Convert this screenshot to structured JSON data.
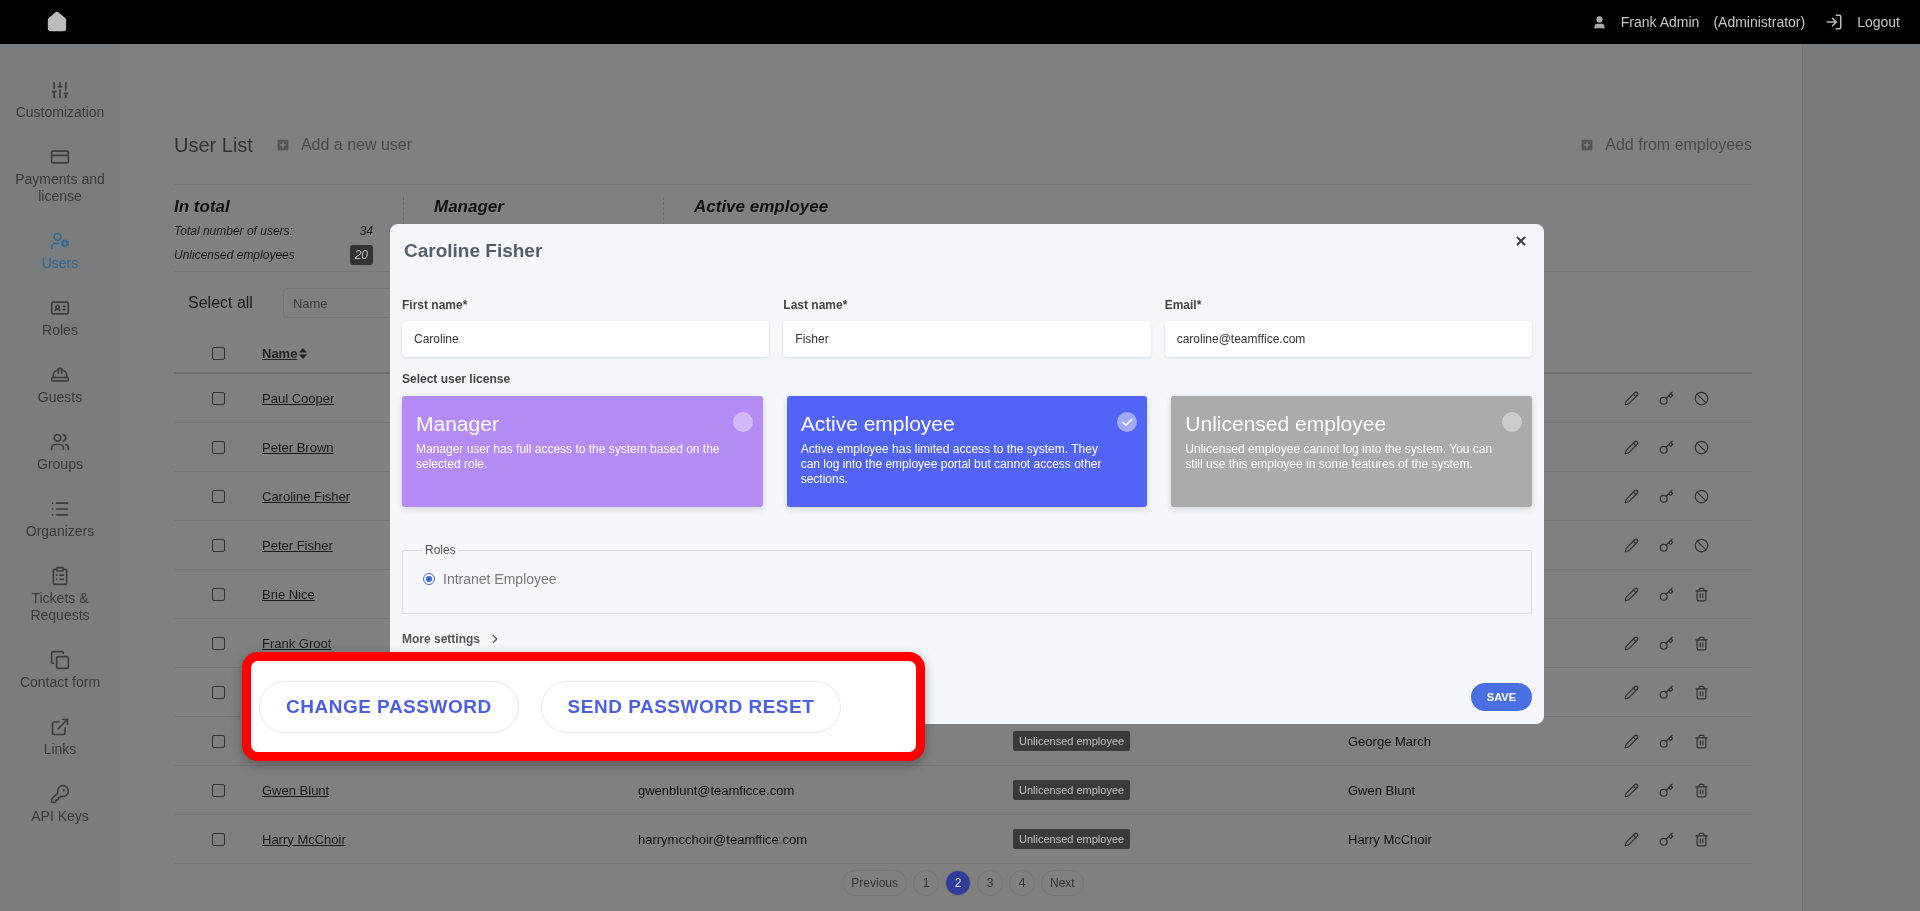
{
  "header": {
    "user": "Frank Admin",
    "role": "(Administrator)",
    "logout": "Logout"
  },
  "sidebar": {
    "items": [
      {
        "label": "Customization",
        "selected": false
      },
      {
        "label": "Payments and license",
        "selected": false
      },
      {
        "label": "Users",
        "selected": true
      },
      {
        "label": "Roles",
        "selected": false
      },
      {
        "label": "Guests",
        "selected": false
      },
      {
        "label": "Groups",
        "selected": false
      },
      {
        "label": "Organizers",
        "selected": false
      },
      {
        "label": "Tickets & Requests",
        "selected": false
      },
      {
        "label": "Contact form",
        "selected": false
      },
      {
        "label": "Links",
        "selected": false
      },
      {
        "label": "API Keys",
        "selected": false
      }
    ]
  },
  "page": {
    "title": "User List",
    "add_user": "Add a new user",
    "add_from": "Add from employees"
  },
  "stats": [
    {
      "title": "In total",
      "lines": [
        {
          "label": "Total number of users:",
          "value": "34",
          "kind": "plain"
        },
        {
          "label": "Unlicensed employees",
          "value": "20",
          "kind": "badge"
        }
      ]
    },
    {
      "title": "Manager"
    },
    {
      "title": "Active employee"
    }
  ],
  "filters": {
    "select_all": "Select all",
    "select_all_checked": false,
    "name_placeholder": "Name"
  },
  "table": {
    "columns": [
      "Name"
    ],
    "rows": [
      {
        "name": "Paul Cooper",
        "checked": false,
        "kind": "deactivate"
      },
      {
        "name": "Peter Brown",
        "checked": false,
        "kind": "deactivate"
      },
      {
        "name": "Caroline Fisher",
        "checked": false,
        "kind": "deactivate"
      },
      {
        "name": "Peter Fisher",
        "checked": false,
        "kind": "deactivate"
      },
      {
        "name": "Brie Nice",
        "checked": false,
        "kind": "delete"
      },
      {
        "name": "Frank Groot",
        "checked": false,
        "kind": "delete"
      },
      {
        "checked": false,
        "kind": "delete"
      },
      {
        "checked": false,
        "kind": "delete",
        "license": "Unlicensed employee",
        "full_name": "George March"
      },
      {
        "name": "Gwen Blunt",
        "checked": false,
        "kind": "delete",
        "email": "gwenblunt@teamficce.com",
        "license": "Unlicensed employee",
        "full_name": "Gwen Blunt"
      },
      {
        "name": "Harry McChoir",
        "checked": false,
        "kind": "delete",
        "email": "harrymcchoir@teamffice.com",
        "license": "Unlicensed employee",
        "full_name": "Harry McChoir"
      }
    ]
  },
  "pagination": {
    "previous": "Previous",
    "pages": [
      {
        "label": "1",
        "selected": false
      },
      {
        "label": "2",
        "selected": true
      },
      {
        "label": "3",
        "selected": false
      },
      {
        "label": "4",
        "selected": false
      }
    ],
    "next": "Next"
  },
  "modal": {
    "title": "Caroline Fisher",
    "fields": [
      {
        "label": "First name*",
        "value": "Caroline"
      },
      {
        "label": "Last name*",
        "value": "Fisher"
      },
      {
        "label": "Email*",
        "value": "caroline@teamffice.com"
      }
    ],
    "license_label": "Select user license",
    "licenses": [
      {
        "title": "Manager",
        "description": "Manager user has full access to the system based on the selected role.",
        "selected": false,
        "color": "#b38cf6"
      },
      {
        "title": "Active employee",
        "description": "Active employee has limited access to the system. They can log into the employee portal but cannot access other sections.",
        "selected": true,
        "color": "#5164f6"
      },
      {
        "title": "Unlicensed employee",
        "description": "Unlicensed employee cannot log into the system. You can still use this employee in some features of the system.",
        "selected": false,
        "color": "#ababab"
      }
    ],
    "roles": {
      "legend": "Roles",
      "options": [
        {
          "label": "Intranet Employee",
          "selected": true
        }
      ]
    },
    "more_settings": "More settings",
    "save": "SAVE"
  },
  "highlight": {
    "buttons": [
      "CHANGE PASSWORD",
      "SEND PASSWORD RESET"
    ]
  }
}
